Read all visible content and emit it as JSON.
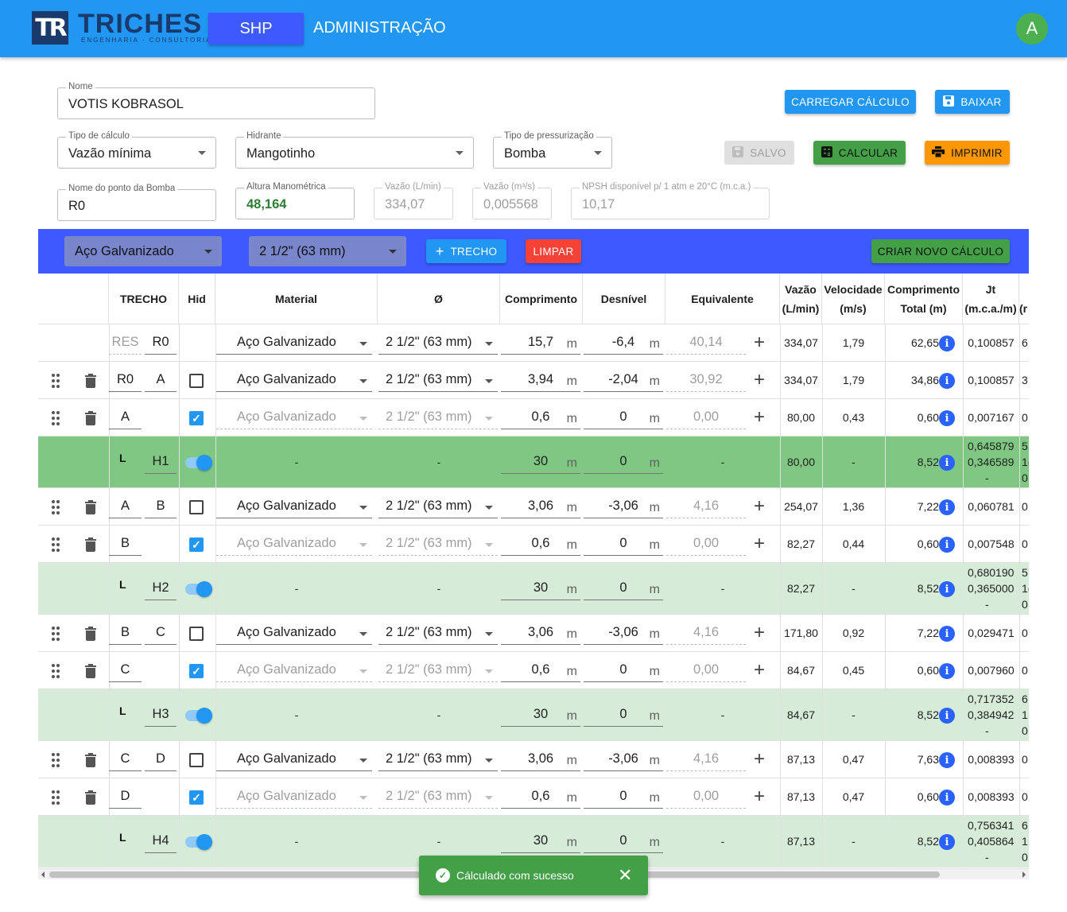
{
  "header": {
    "logo_name": "TRICHES",
    "logo_sub": "ENGENHARIA · CONSULTORIA",
    "logo_mark": "TR",
    "nav_shp": "SHP",
    "nav_admin": "ADMINISTRAÇÃO",
    "avatar": "A"
  },
  "form": {
    "nome": {
      "label": "Nome",
      "value": "VOTIS KOBRASOL"
    },
    "tipo_calculo": {
      "label": "Tipo de cálculo",
      "value": "Vazão mínima"
    },
    "hidrante": {
      "label": "Hidrante",
      "value": "Mangotinho"
    },
    "tipo_pressurizacao": {
      "label": "Tipo de pressurização",
      "value": "Bomba"
    },
    "ponto_bomba": {
      "label": "Nome do ponto da Bomba",
      "value": "R0"
    },
    "altura_manometrica": {
      "label": "Altura Manométrica",
      "value": "48,164"
    },
    "vazao_lmin": {
      "label": "Vazão (L/min)",
      "value": "334,07"
    },
    "vazao_m3s": {
      "label": "Vazão (m³/s)",
      "value": "0,005568"
    },
    "npsh": {
      "label": "NPSH disponível p/ 1 atm e 20°C (m.c.a.)",
      "value": "10,17"
    }
  },
  "buttons": {
    "carregar": "CARREGAR CÁLCULO",
    "baixar": "BAIXAR",
    "salvo": "SALVO",
    "calcular": "CALCULAR",
    "imprimir": "IMPRIMIR",
    "trecho": "TRECHO",
    "limpar": "LIMPAR",
    "criar_novo": "CRIAR NOVO CÁLCULO"
  },
  "toolbar": {
    "material": "Aço Galvanizado",
    "diametro": "2 1/2\" (63 mm)"
  },
  "columns": {
    "trecho": "TRECHO",
    "hid": "Hid",
    "material": "Material",
    "diam": "Ø",
    "comprimento": "Comprimento",
    "desnivel": "Desnível",
    "equivalente": "Equivalente",
    "vazao_1": "Vazão",
    "vazao_2": "(L/min)",
    "velocidade_1": "Velocidade",
    "velocidade_2": "(m/s)",
    "ct_1": "Comprimento",
    "ct_2": "Total (m)",
    "jt_1": "Jt",
    "jt_2": "(m.c.a./m)",
    "next_2": "(r"
  },
  "unit": "m",
  "dash": "-",
  "elbow": "L",
  "rows": [
    {
      "kind": "first",
      "from": "RES",
      "to": "R0",
      "material": "Aço Galvanizado",
      "diam": "2 1/2\" (63 mm)",
      "comp": "15,7",
      "desn": "-6,4",
      "equiv": "40,14",
      "vazao": "334,07",
      "vel": "1,79",
      "ct": "62,65",
      "jt": "0,100857",
      "next": "6"
    },
    {
      "kind": "pipe",
      "from": "R0",
      "to": "A",
      "material": "Aço Galvanizado",
      "diam": "2 1/2\" (63 mm)",
      "comp": "3,94",
      "desn": "-2,04",
      "equiv": "30,92",
      "vazao": "334,07",
      "vel": "1,79",
      "ct": "34,86",
      "jt": "0,100857",
      "next": "3"
    },
    {
      "kind": "riser",
      "from": "A",
      "to": "",
      "material": "Aço Galvanizado",
      "diam": "2 1/2\" (63 mm)",
      "comp": "0,6",
      "desn": "0",
      "equiv": "0,00",
      "vazao": "80,00",
      "vel": "0,43",
      "ct": "0,60",
      "jt": "0,007167",
      "next": "0"
    },
    {
      "kind": "hydrant",
      "shade": "dark",
      "name": "H1",
      "comp": "30",
      "desn": "0",
      "vazao": "80,00",
      "ct": "8,52",
      "jt1": "0,645879",
      "jt2": "0,346589",
      "next1": "5",
      "next2": "1(",
      "next3": "0"
    },
    {
      "kind": "pipe",
      "from": "A",
      "to": "B",
      "material": "Aço Galvanizado",
      "diam": "2 1/2\" (63 mm)",
      "comp": "3,06",
      "desn": "-3,06",
      "equiv": "4,16",
      "vazao": "254,07",
      "vel": "1,36",
      "ct": "7,22",
      "jt": "0,060781",
      "next": "0"
    },
    {
      "kind": "riser",
      "from": "B",
      "to": "",
      "material": "Aço Galvanizado",
      "diam": "2 1/2\" (63 mm)",
      "comp": "0,6",
      "desn": "0",
      "equiv": "0,00",
      "vazao": "82,27",
      "vel": "0,44",
      "ct": "0,60",
      "jt": "0,007548",
      "next": "0"
    },
    {
      "kind": "hydrant",
      "shade": "light",
      "name": "H2",
      "comp": "30",
      "desn": "0",
      "vazao": "82,27",
      "ct": "8,52",
      "jt1": "0,680190",
      "jt2": "0,365000",
      "next1": "5",
      "next2": "1(",
      "next3": "0"
    },
    {
      "kind": "pipe",
      "from": "B",
      "to": "C",
      "material": "Aço Galvanizado",
      "diam": "2 1/2\" (63 mm)",
      "comp": "3,06",
      "desn": "-3,06",
      "equiv": "4,16",
      "vazao": "171,80",
      "vel": "0,92",
      "ct": "7,22",
      "jt": "0,029471",
      "next": "0"
    },
    {
      "kind": "riser",
      "from": "C",
      "to": "",
      "material": "Aço Galvanizado",
      "diam": "2 1/2\" (63 mm)",
      "comp": "0,6",
      "desn": "0",
      "equiv": "0,00",
      "vazao": "84,67",
      "vel": "0,45",
      "ct": "0,60",
      "jt": "0,007960",
      "next": "0"
    },
    {
      "kind": "hydrant",
      "shade": "light",
      "name": "H3",
      "comp": "30",
      "desn": "0",
      "vazao": "84,67",
      "ct": "8,52",
      "jt1": "0,717352",
      "jt2": "0,384942",
      "next1": "6",
      "next2": "1",
      "next3": "0"
    },
    {
      "kind": "pipe",
      "from": "C",
      "to": "D",
      "material": "Aço Galvanizado",
      "diam": "2 1/2\" (63 mm)",
      "comp": "3,06",
      "desn": "-3,06",
      "equiv": "4,16",
      "vazao": "87,13",
      "vel": "0,47",
      "ct": "7,63",
      "jt": "0,008393",
      "next": "0"
    },
    {
      "kind": "riser",
      "from": "D",
      "to": "",
      "material": "Aço Galvanizado",
      "diam": "2 1/2\" (63 mm)",
      "comp": "0,6",
      "desn": "0",
      "equiv": "0,00",
      "vazao": "87,13",
      "vel": "0,47",
      "ct": "0,60",
      "jt": "0,008393",
      "next": "0"
    },
    {
      "kind": "hydrant",
      "shade": "light",
      "name": "H4",
      "comp": "30",
      "desn": "0",
      "vazao": "87,13",
      "ct": "8,52",
      "jt1": "0,756341",
      "jt2": "0,405864",
      "next1": "6",
      "next2": "1:",
      "next3": "0"
    }
  ],
  "snackbar": {
    "message": "Cálculado com sucesso",
    "close": "✕",
    "icon": "check-circle-icon"
  },
  "colors": {
    "primary": "#2196f3",
    "toolbar": "#3d5afe",
    "success": "#43a047",
    "warning": "#ff9800",
    "danger": "#f44336",
    "hydrant_dark": "#81c784",
    "hydrant_light": "#d6ecd8"
  }
}
